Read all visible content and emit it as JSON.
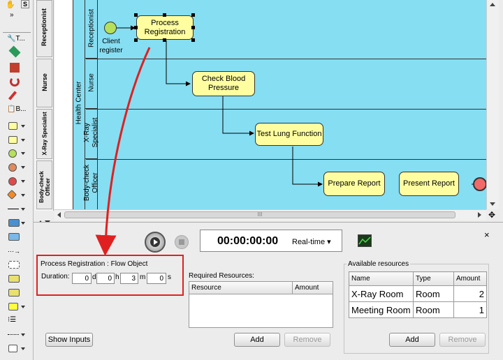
{
  "toolbar": {
    "top_s": "S",
    "tool_labels": [
      "T...",
      "B..."
    ],
    "colors": {
      "yellow": "#fefea0",
      "green": "#b6e05a",
      "red": "#e04a4a",
      "orange": "#f08a2a",
      "blue": "#4a90d0"
    }
  },
  "lanes": {
    "tabs": [
      "Receptionist",
      "Nurse",
      "X-Ray Specialist",
      "Body-check Officer"
    ],
    "pool_label": "Health Center",
    "headers": [
      "Receptionist",
      "Nurse",
      "X-Ray Specialist",
      "Body-check Officer"
    ]
  },
  "diagram": {
    "start_event_label": "Client register",
    "tasks": [
      "Process Registration",
      "Check Blood Pressure",
      "Test Lung Function",
      "Prepare Report",
      "Present Report"
    ],
    "colors": {
      "pool": "#86def2",
      "task": "#fefea0",
      "start": "#b6e05a",
      "end": "#f06a6a",
      "annotation": "#e02020"
    }
  },
  "simulation": {
    "timer": "00:00:00:00",
    "mode": "Real-time"
  },
  "flow_object": {
    "title": "Process Registration : Flow Object",
    "duration_label": "Duration:",
    "duration": {
      "d": "0",
      "h": "0",
      "m": "3",
      "s": "0"
    },
    "units": {
      "d": "d",
      "h": "h",
      "m": "m",
      "s": "s"
    },
    "show_inputs_label": "Show Inputs"
  },
  "required_resources": {
    "title": "Required Resources:",
    "columns": [
      "Resource",
      "Amount"
    ],
    "add_label": "Add",
    "remove_label": "Remove"
  },
  "available_resources": {
    "title": "Available resources",
    "columns": [
      "Name",
      "Type",
      "Amount"
    ],
    "rows": [
      {
        "name": "X-Ray Room",
        "type": "Room",
        "amount": "2"
      },
      {
        "name": "Meeting Room",
        "type": "Room",
        "amount": "1"
      }
    ],
    "add_label": "Add",
    "remove_label": "Remove"
  },
  "scroll": {
    "hthumb": "III"
  }
}
